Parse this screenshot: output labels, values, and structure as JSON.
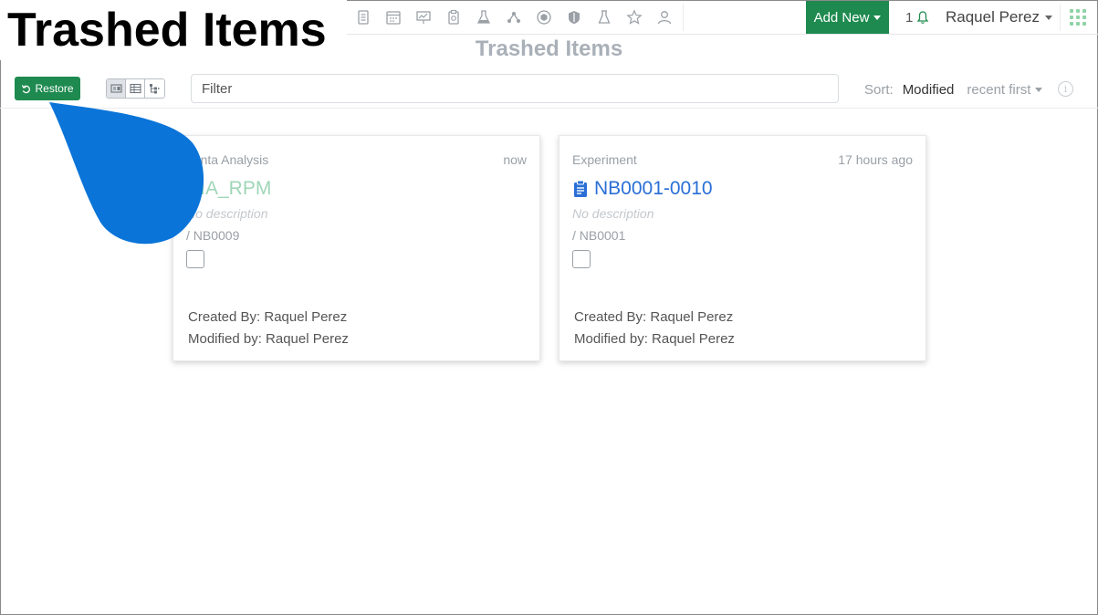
{
  "overlay": {
    "title": "Trashed Items"
  },
  "nav": {
    "icons": [
      "notebook-icon",
      "calendar-icon",
      "presentation-icon",
      "clipboard-icon",
      "lab-flask-icon",
      "molecule-icon",
      "hexagon-icon",
      "shield-icon",
      "beaker-icon",
      "star-icon",
      "user-icon"
    ],
    "add_new_label": "Add New",
    "notification_count": "1",
    "user_name": "Raquel Perez"
  },
  "page": {
    "title": "Trashed Items"
  },
  "toolbar": {
    "restore_label": "Restore",
    "filter_placeholder": "Filter",
    "sort_label": "Sort:",
    "sort_field": "Modified",
    "sort_order": "recent first",
    "info_symbol": "i"
  },
  "cards": [
    {
      "type": "Lenta Analysis",
      "time": "now",
      "title": "NIA_RPM",
      "description": "No description",
      "path": "/ NB0009",
      "created_by": "Created By: Raquel Perez",
      "modified_by": "Modified by: Raquel Perez"
    },
    {
      "type": "Experiment",
      "time": "17 hours ago",
      "title": "NB0001-0010",
      "description": "No description",
      "path": "/ NB0001",
      "created_by": "Created By: Raquel Perez",
      "modified_by": "Modified by: Raquel Perez"
    }
  ],
  "colors": {
    "brand_green": "#1e8a4f",
    "link_blue": "#2a6fd6",
    "annotation_blue": "#0a74d8"
  }
}
